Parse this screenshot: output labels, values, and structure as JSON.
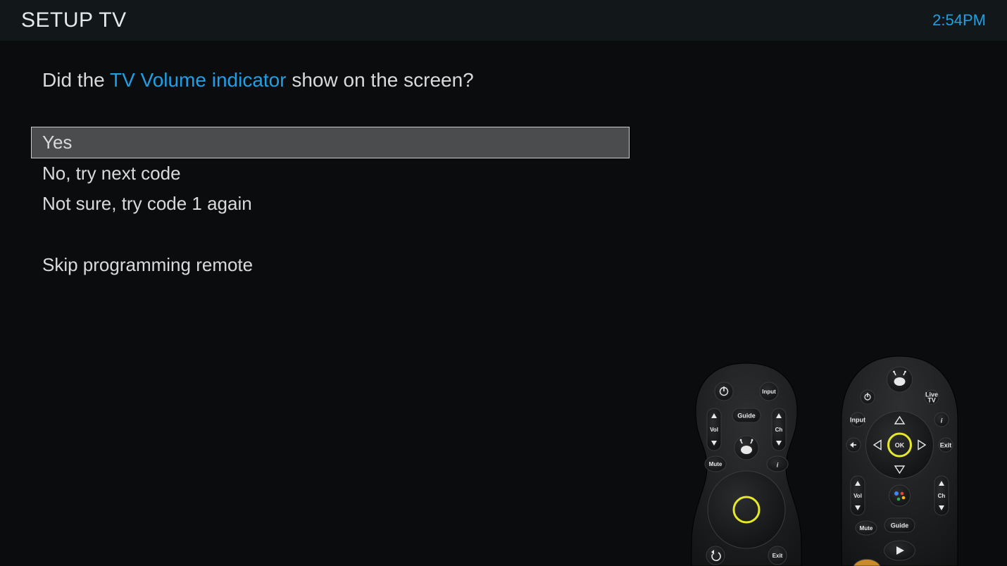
{
  "header": {
    "title": "SETUP TV",
    "time": "2:54PM"
  },
  "question": {
    "pre": "Did the ",
    "highlight": "TV Volume indicator",
    "post": " show on the screen?"
  },
  "options": {
    "yes": "Yes",
    "no": "No, try next code",
    "notsure": "Not sure, try code 1 again",
    "skip": "Skip programming remote"
  },
  "remoteA": {
    "power": "power-icon",
    "input": "Input",
    "guide": "Guide",
    "vol": "Vol",
    "ch": "Ch",
    "mute": "Mute",
    "info": "i",
    "back": "back-icon",
    "exit": "Exit"
  },
  "remoteB": {
    "power": "power-icon",
    "liveTv1": "Live",
    "liveTv2": "TV",
    "input": "Input",
    "info": "i",
    "ok": "OK",
    "back": "back-icon",
    "exit": "Exit",
    "vol": "Vol",
    "ch": "Ch",
    "mute": "Mute",
    "guide": "Guide"
  }
}
